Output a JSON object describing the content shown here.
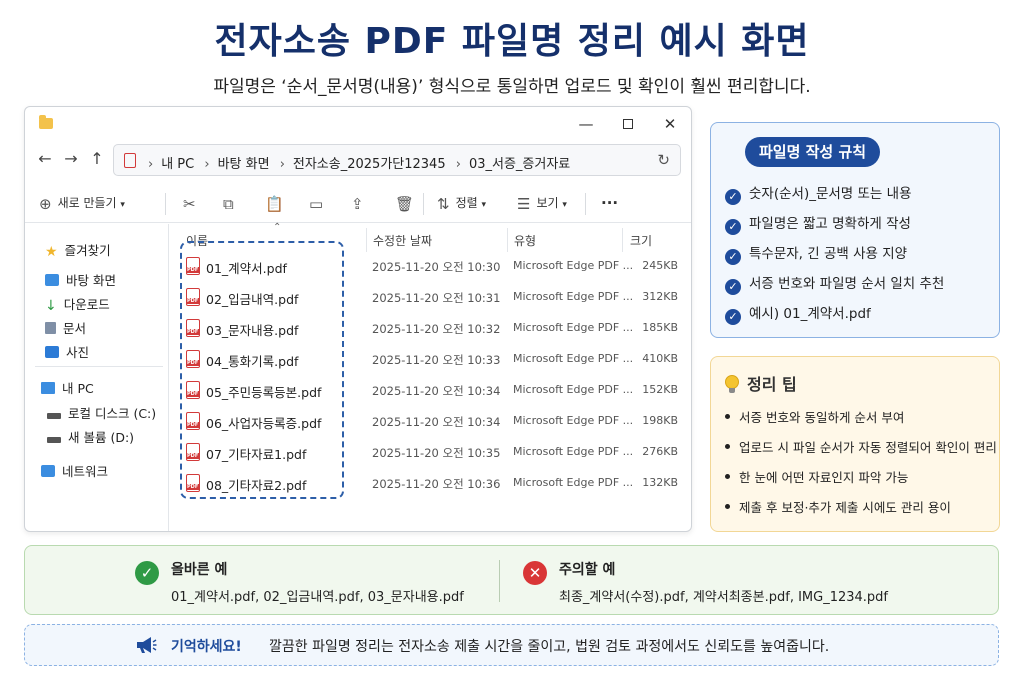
{
  "title": "전자소송 PDF 파일명 정리 예시 화면",
  "subtitle": "파일명은 ‘순서_문서명(내용)’ 형식으로 통일하면 업로드 및 확인이 훨씬 편리합니다.",
  "explorer": {
    "address": [
      "내 PC",
      "바탕 화면",
      "전자소송_2025가단12345",
      "03_서증_증거자료"
    ],
    "toolbar": {
      "new": "새로 만들기",
      "sort": "정렬",
      "view": "보기",
      "more": "···"
    },
    "sidebar": {
      "favorites": "즐겨찾기",
      "desktop": "바탕 화면",
      "downloads": "다운로드",
      "documents": "문서",
      "pictures": "사진",
      "pc": "내 PC",
      "local_disk": "로컬 디스크 (C:)",
      "new_volume": "새 볼륨 (D:)",
      "network": "네트워크"
    },
    "columns": {
      "name": "이름",
      "date": "수정한 날짜",
      "type": "유형",
      "size": "크기"
    },
    "files": [
      {
        "name": "01_계약서.pdf",
        "date": "2025-11-20 오전 10:30",
        "type": "Microsoft Edge PDF ...",
        "size": "245KB"
      },
      {
        "name": "02_입금내역.pdf",
        "date": "2025-11-20 오전 10:31",
        "type": "Microsoft Edge PDF ...",
        "size": "312KB"
      },
      {
        "name": "03_문자내용.pdf",
        "date": "2025-11-20 오전 10:32",
        "type": "Microsoft Edge PDF ...",
        "size": "185KB"
      },
      {
        "name": "04_통화기록.pdf",
        "date": "2025-11-20 오전 10:33",
        "type": "Microsoft Edge PDF ...",
        "size": "410KB"
      },
      {
        "name": "05_주민등록등본.pdf",
        "date": "2025-11-20 오전 10:34",
        "type": "Microsoft Edge PDF ...",
        "size": "152KB"
      },
      {
        "name": "06_사업자등록증.pdf",
        "date": "2025-11-20 오전 10:34",
        "type": "Microsoft Edge PDF ...",
        "size": "198KB"
      },
      {
        "name": "07_기타자료1.pdf",
        "date": "2025-11-20 오전 10:35",
        "type": "Microsoft Edge PDF ...",
        "size": "276KB"
      },
      {
        "name": "08_기타자료2.pdf",
        "date": "2025-11-20 오전 10:36",
        "type": "Microsoft Edge PDF ...",
        "size": "132KB"
      }
    ]
  },
  "rules": {
    "title": "파일명 작성 규칙",
    "items": [
      "숫자(순서)_문서명 또는 내용",
      "파일명은 짧고 명확하게 작성",
      "특수문자, 긴 공백 사용 지양",
      "서증 번호와 파일명 순서 일치 추천",
      "예시) 01_계약서.pdf"
    ]
  },
  "tips": {
    "title": "정리 팁",
    "items": [
      "서증 번호와 동일하게 순서 부여",
      "업로드 시 파일 순서가 자동 정렬되어 확인이 편리",
      "한 눈에 어떤 자료인지 파악 가능",
      "제출 후 보정·추가 제출 시에도 관리 용이"
    ]
  },
  "examples": {
    "good_title": "올바른 예",
    "good_text": "01_계약서.pdf, 02_입금내역.pdf, 03_문자내용.pdf",
    "bad_title": "주의할 예",
    "bad_text": "최종_계약서(수정).pdf, 계약서최종본.pdf, IMG_1234.pdf"
  },
  "remember": {
    "label": "기억하세요!",
    "text": "깔끔한 파일명 정리는 전자소송 제출 시간을 줄이고, 법원 검토 과정에서도 신뢰도를 높여줍니다."
  },
  "colors": {
    "title": "#15306b",
    "accent": "#1f4c9c",
    "pdf_red": "#d23a3a",
    "good_green": "#2f9a45",
    "bad_red": "#d93636"
  },
  "icons": [
    "folder-icon",
    "back-arrow-icon",
    "forward-arrow-icon",
    "up-arrow-icon",
    "pdf-icon",
    "refresh-icon",
    "cut-icon",
    "copy-icon",
    "paste-icon",
    "rename-icon",
    "share-icon",
    "trash-icon",
    "checkmark-icon",
    "lightbulb-icon",
    "megaphone-icon"
  ]
}
